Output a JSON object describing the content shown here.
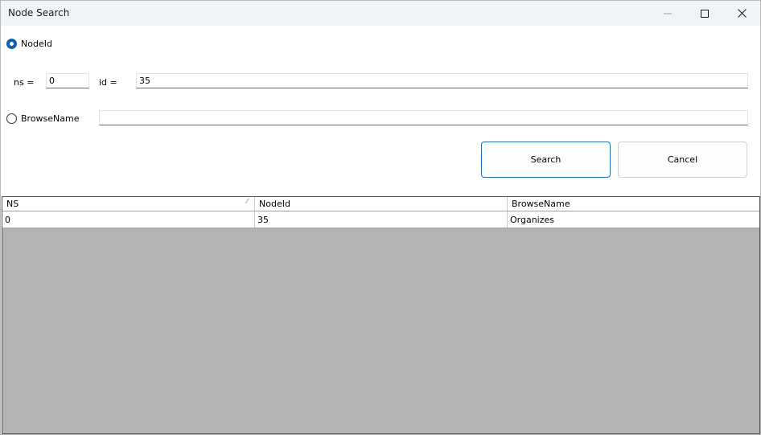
{
  "window": {
    "title": "Node Search"
  },
  "form": {
    "nodeid_radio_label": "NodeId",
    "ns_label": "ns =",
    "ns_value": "0",
    "id_label": "id =",
    "id_value": "35",
    "browsename_radio_label": "BrowseName",
    "browsename_value": "",
    "nodeid_selected": true,
    "browsename_selected": false
  },
  "buttons": {
    "search_label": "Search",
    "cancel_label": "Cancel"
  },
  "results": {
    "columns": [
      "NS",
      "NodeId",
      "BrowseName"
    ],
    "rows": [
      [
        "0",
        "35",
        "Organizes"
      ]
    ]
  }
}
